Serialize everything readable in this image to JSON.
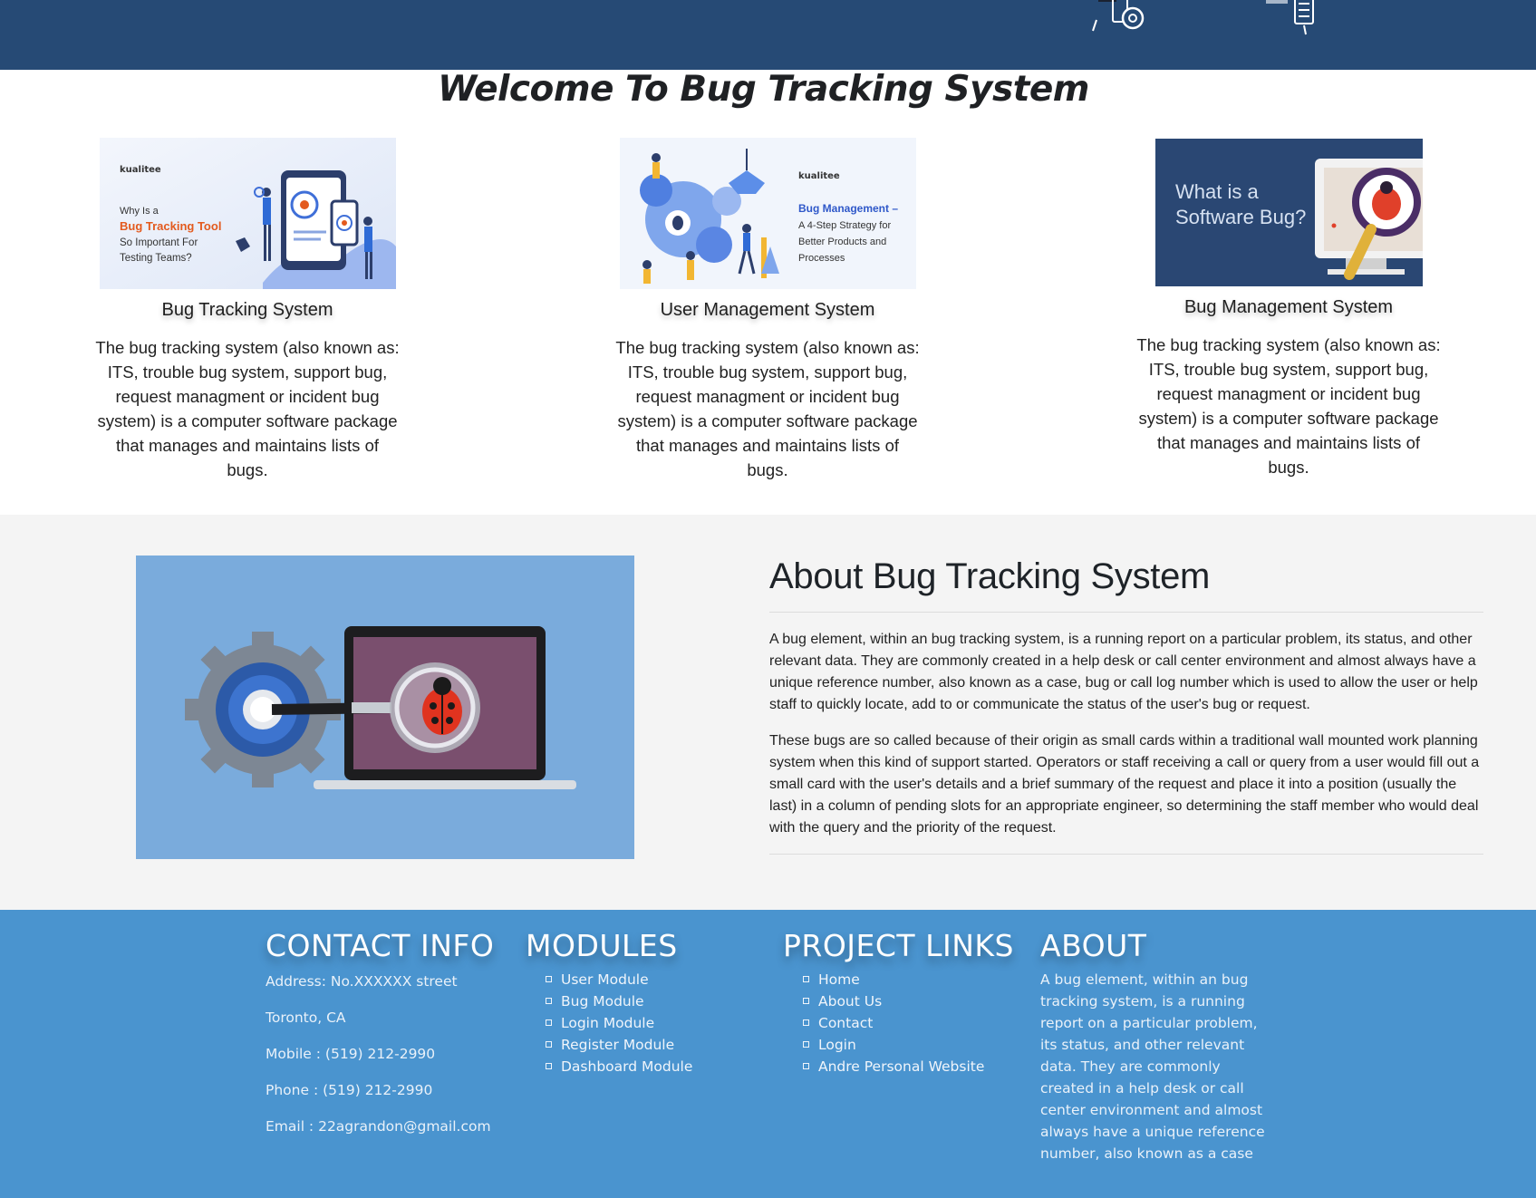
{
  "page": {
    "welcome_title": "Welcome To Bug Tracking System"
  },
  "cards": [
    {
      "title": "Bug Tracking System",
      "text": "The bug tracking system (also known as: ITS, trouble bug system, support bug, request managment or incident bug system) is a computer software package that manages and maintains lists of bugs.",
      "image": {
        "brand": "kualitee",
        "line1": "Why Is a",
        "line2": "Bug Tracking Tool",
        "line3": "So Important For",
        "line4": "Testing Teams?"
      }
    },
    {
      "title": "User Management System",
      "text": "The bug tracking system (also known as: ITS, trouble bug system, support bug, request managment or incident bug system) is a computer software package that manages and maintains lists of bugs.",
      "image": {
        "brand": "kualitee",
        "line1": "Bug Management –",
        "line2": "A 4-Step Strategy for",
        "line3": "Better Products and",
        "line4": "Processes"
      }
    },
    {
      "title": "Bug Management System",
      "text": "The bug tracking system (also known as: ITS, trouble bug system, support bug, request managment or incident bug system) is a computer software package that manages and maintains lists of bugs.",
      "image": {
        "line1": "What is a",
        "line2": "Software Bug?"
      }
    }
  ],
  "about": {
    "title": "About Bug Tracking System",
    "paragraph1": "A bug element, within an bug tracking system, is a running report on a particular problem, its status, and other relevant data. They are commonly created in a help desk or call center environment and almost always have a unique reference number, also known as a case, bug or call log number which is used to allow the user or help staff to quickly locate, add to or communicate the status of the user's bug or request.",
    "paragraph2": "These bugs are so called because of their origin as small cards within a traditional wall mounted work planning system when this kind of support started. Operators or staff receiving a call or query from a user would fill out a small card with the user's details and a brief summary of the request and place it into a position (usually the last) in a column of pending slots for an appropriate engineer, so determining the staff member who would deal with the query and the priority of the request."
  },
  "footer": {
    "contact": {
      "heading": "CONTACT INFO",
      "address": "Address: No.XXXXXX street",
      "city": "Toronto, CA",
      "mobile": "Mobile : (519) 212-2990",
      "phone": "Phone : (519) 212-2990",
      "email": "Email : 22agrandon@gmail.com"
    },
    "modules": {
      "heading": "MODULES",
      "items": [
        "User Module",
        "Bug Module",
        "Login Module",
        "Register Module",
        "Dashboard Module"
      ]
    },
    "links": {
      "heading": "PROJECT LINKS",
      "items": [
        "Home",
        "About Us",
        "Contact",
        "Login",
        "Andre Personal Website"
      ]
    },
    "about": {
      "heading": "ABOUT",
      "text": "A bug element, within an bug tracking system, is a running report on a particular problem, its status, and other relevant data. They are commonly created in a help desk or call center environment and almost always have a unique reference number, also known as a case"
    }
  },
  "colors": {
    "header_bg": "#264a75",
    "footer_bg": "#4a94cf",
    "about_bg": "#f4f4f4",
    "about_image_bg": "#7aabdc"
  },
  "icons": [
    "stopwatch-document-icon",
    "checklist-clipboard-icon",
    "bug-icon",
    "magnifier-icon",
    "gear-icon",
    "laptop-icon",
    "ladybug-icon"
  ]
}
